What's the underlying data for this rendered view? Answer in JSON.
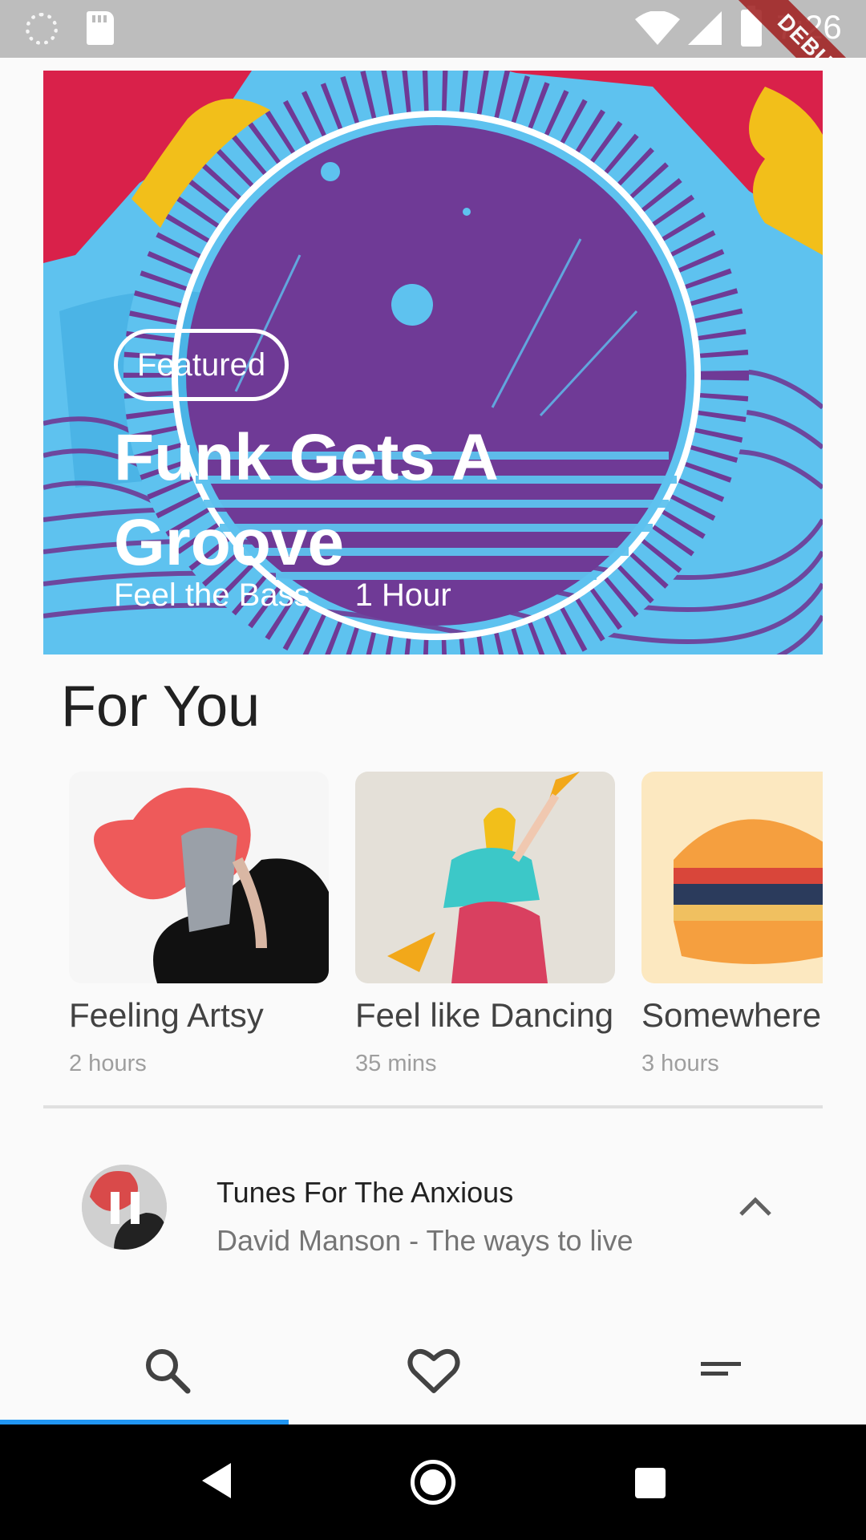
{
  "status_bar": {
    "time": "7:26",
    "debug_label": "DEBUG"
  },
  "hero": {
    "tag": "Featured",
    "title": "Funk Gets A Groove",
    "subtitle": "Feel the Bass",
    "duration": "1 Hour",
    "colors": {
      "bg": "#5ec2ef",
      "planet": "#6f3a96",
      "accent_red": "#d9214a",
      "accent_yellow": "#f2bf1a"
    }
  },
  "for_you": {
    "title": "For You",
    "items": [
      {
        "title": "Feeling Artsy",
        "duration": "2 hours"
      },
      {
        "title": "Feel like Dancing",
        "duration": "35 mins"
      },
      {
        "title": "Somewhere",
        "duration": "3 hours"
      }
    ]
  },
  "now_playing": {
    "title": "Tunes For The Anxious",
    "subtitle": "David Manson - The ways to live",
    "state": "playing",
    "icons": {
      "toggle": "pause-icon",
      "expand": "chevron-up-icon"
    }
  },
  "bottom_nav": {
    "tabs": [
      {
        "icon": "search-icon",
        "selected": true
      },
      {
        "icon": "heart-icon",
        "selected": false
      },
      {
        "icon": "menu-icon",
        "selected": false
      }
    ],
    "indicator_color": "#2196f3"
  }
}
